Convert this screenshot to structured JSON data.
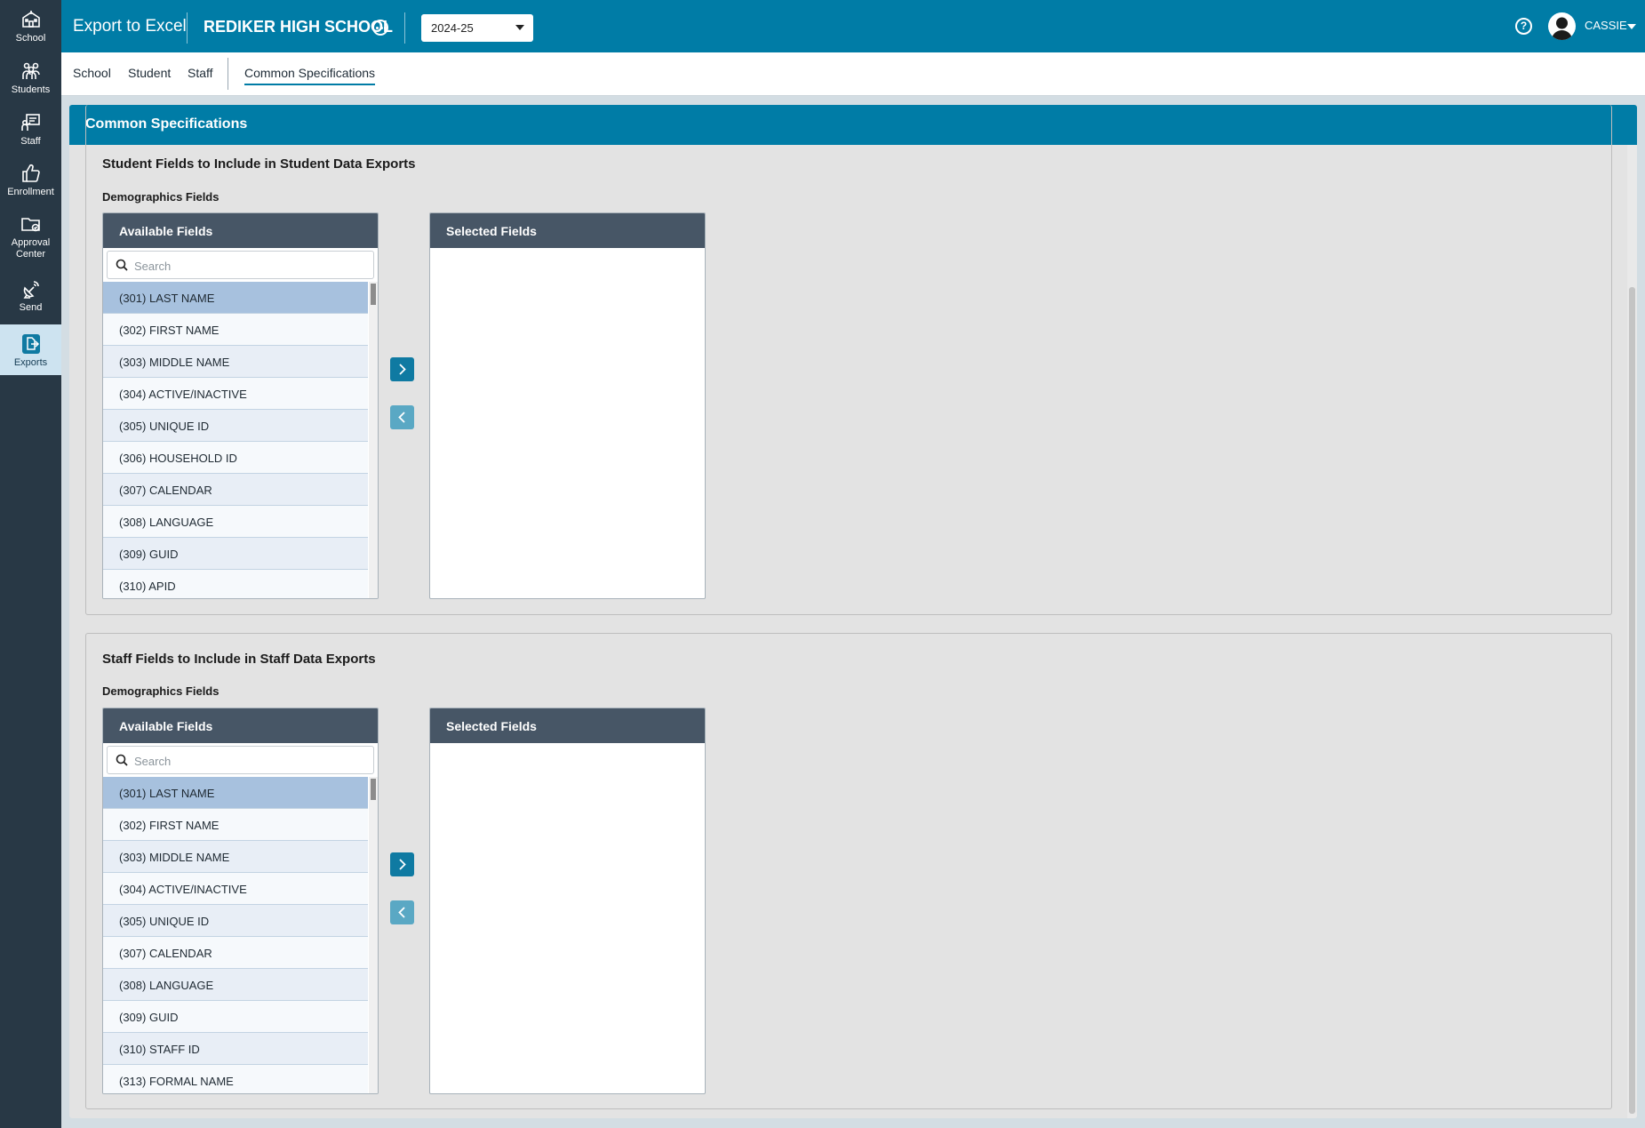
{
  "nav": {
    "items": [
      {
        "label": "School",
        "icon": "school-icon"
      },
      {
        "label": "Students",
        "icon": "students-icon"
      },
      {
        "label": "Staff",
        "icon": "staff-icon"
      },
      {
        "label": "Enrollment",
        "icon": "thumbs-up-icon"
      },
      {
        "label": "Approval Center",
        "icon": "folder-check-icon"
      },
      {
        "label": "Send",
        "icon": "satellite-icon"
      },
      {
        "label": "Exports",
        "icon": "export-icon",
        "active": true
      }
    ]
  },
  "header": {
    "app_title": "Export to Excel",
    "school_name": "REDIKER HIGH SCHOOL",
    "school_year": "2024-25",
    "user_name": "CASSIE"
  },
  "tabs": [
    {
      "label": "School"
    },
    {
      "label": "Student"
    },
    {
      "label": "Staff"
    },
    {
      "label": "Common Specifications",
      "active": true
    }
  ],
  "panel": {
    "title": "Common Specifications"
  },
  "student_section": {
    "title": "Student Fields to Include in Student Data Exports",
    "subtitle": "Demographics Fields",
    "available_label": "Available Fields",
    "selected_label": "Selected Fields",
    "search_placeholder": "Search",
    "fields": [
      "(301) LAST NAME",
      "(302) FIRST NAME",
      "(303) MIDDLE NAME",
      "(304) ACTIVE/INACTIVE",
      "(305) UNIQUE ID",
      "(306) HOUSEHOLD ID",
      "(307) CALENDAR",
      "(308) LANGUAGE",
      "(309) GUID",
      "(310) APID"
    ]
  },
  "staff_section": {
    "title": "Staff Fields to Include in Staff Data Exports",
    "subtitle": "Demographics Fields",
    "available_label": "Available Fields",
    "selected_label": "Selected Fields",
    "search_placeholder": "Search",
    "fields": [
      "(301) LAST NAME",
      "(302) FIRST NAME",
      "(303) MIDDLE NAME",
      "(304) ACTIVE/INACTIVE",
      "(305) UNIQUE ID",
      "(307) CALENDAR",
      "(308) LANGUAGE",
      "(309) GUID",
      "(310) STAFF ID",
      "(313) FORMAL NAME"
    ]
  },
  "colors": {
    "accent": "#007ca6",
    "rail": "#283845",
    "list_header": "#475666",
    "row_selected": "#a7c1de"
  }
}
